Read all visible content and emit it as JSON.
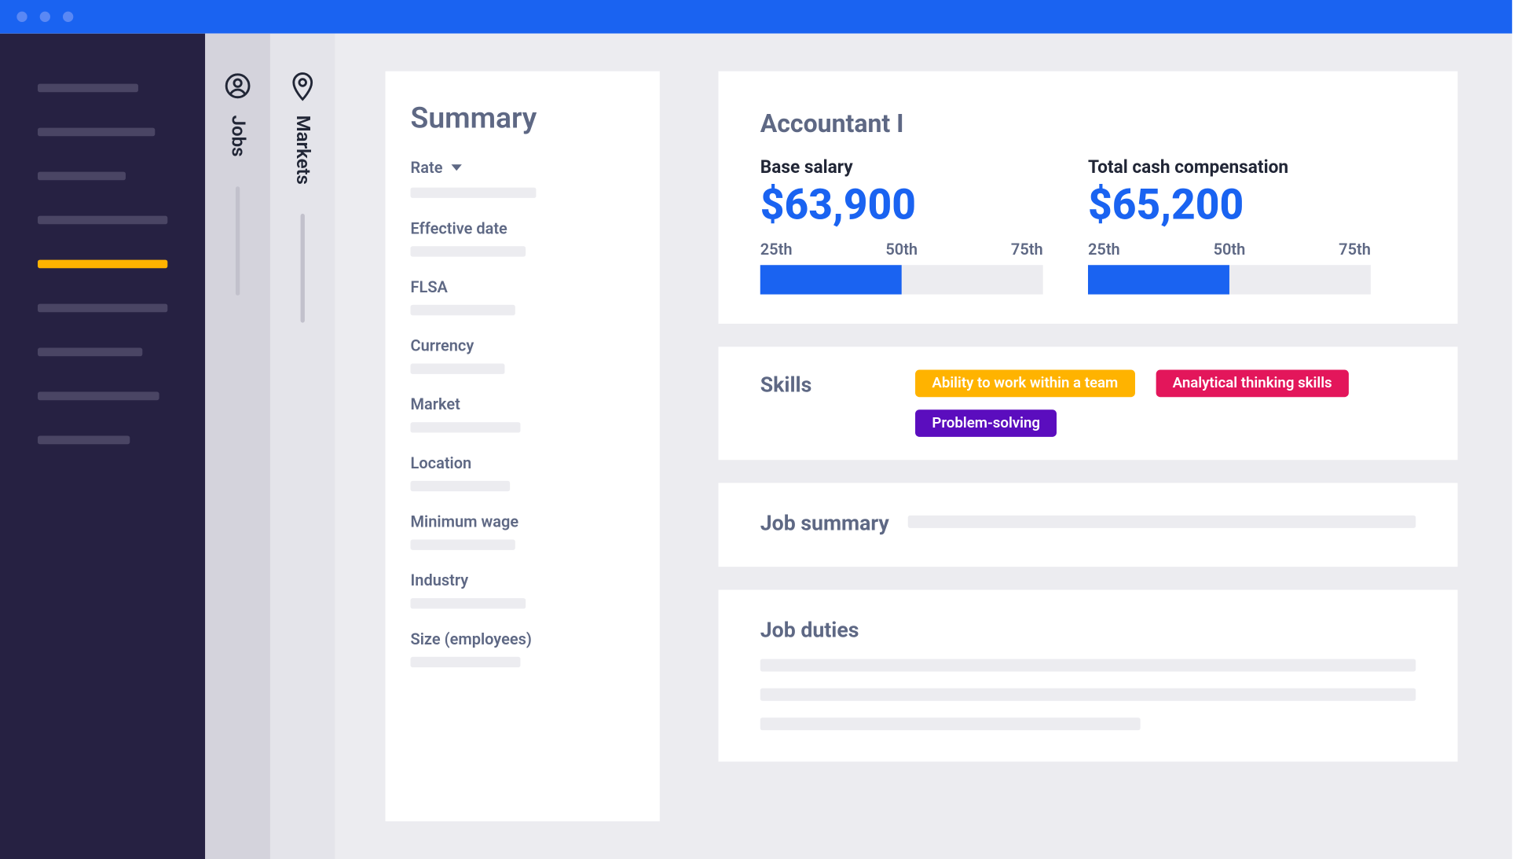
{
  "vtabs": {
    "jobs": "Jobs",
    "markets": "Markets"
  },
  "summary": {
    "title": "Summary",
    "rate_label": "Rate",
    "fields": {
      "effective_date": "Effective date",
      "flsa": "FLSA",
      "currency": "Currency",
      "market": "Market",
      "location": "Location",
      "minimum_wage": "Minimum wage",
      "industry": "Industry",
      "size": "Size (employees)"
    }
  },
  "job": {
    "title": "Accountant I",
    "base": {
      "label": "Base salary",
      "value": "$63,900",
      "percentile_fill": 50
    },
    "total": {
      "label": "Total cash compensation",
      "value": "$65,200",
      "percentile_fill": 50
    },
    "percentiles": [
      "25th",
      "50th",
      "75th"
    ]
  },
  "skills": {
    "label": "Skills",
    "items": [
      {
        "text": "Ability to work within a team",
        "color": "yellow"
      },
      {
        "text": "Analytical thinking skills",
        "color": "pink"
      },
      {
        "text": "Problem-solving",
        "color": "purple"
      }
    ]
  },
  "sections": {
    "job_summary": "Job summary",
    "job_duties": "Job duties"
  }
}
